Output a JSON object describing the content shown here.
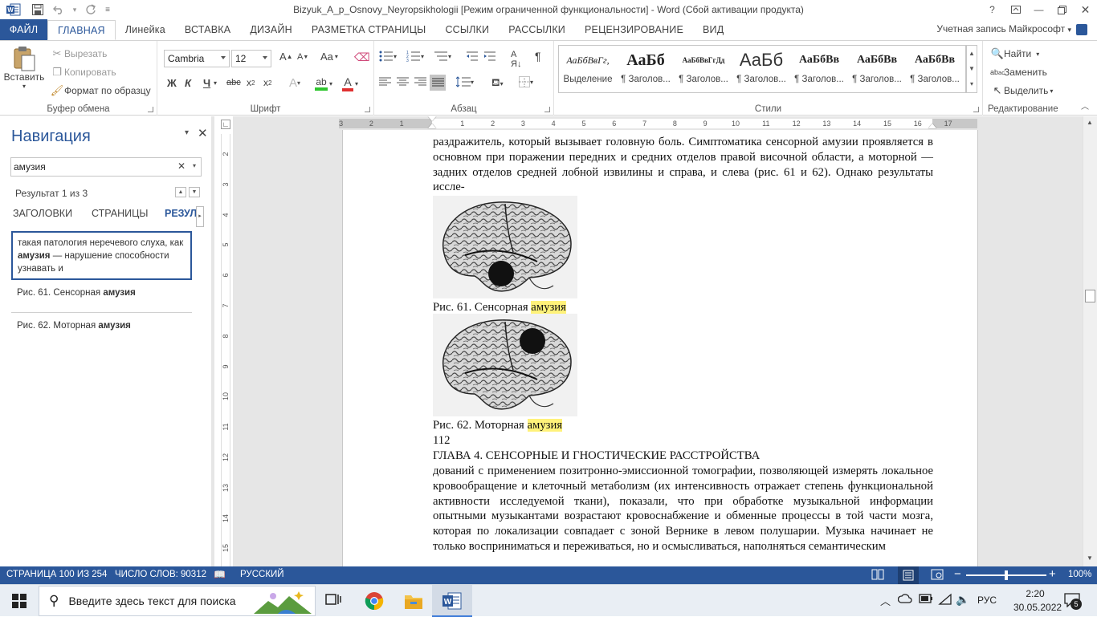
{
  "window": {
    "title": "Bizyuk_A_p_Osnovy_Neyropsikhologii [Режим ограниченной функциональности] - Word (Сбой активации продукта)",
    "account": "Учетная запись Майкрософт",
    "help": "?"
  },
  "tabs": [
    "ФАЙЛ",
    "ГЛАВНАЯ",
    "Линейка",
    "ВСТАВКА",
    "ДИЗАЙН",
    "РАЗМЕТКА СТРАНИЦЫ",
    "ССЫЛКИ",
    "РАССЫЛКИ",
    "РЕЦЕНЗИРОВАНИЕ",
    "ВИД"
  ],
  "ribbon": {
    "clipboard": {
      "label": "Буфер обмена",
      "paste": "Вставить",
      "cut": "Вырезать",
      "copy": "Копировать",
      "format_painter": "Формат по образцу"
    },
    "font": {
      "label": "Шрифт",
      "font_name": "Cambria",
      "font_size": "12",
      "bold": "Ж",
      "italic": "К",
      "underline": "Ч",
      "strike": "abc",
      "change_case": "Aa"
    },
    "paragraph": {
      "label": "Абзац"
    },
    "styles": {
      "label": "Стили",
      "items": [
        {
          "preview": "АаБбВвГг,",
          "name": "Выделение"
        },
        {
          "preview": "АаБб",
          "name": "¶ Заголов..."
        },
        {
          "preview": "АаБбВвГгДд",
          "name": "¶ Заголов..."
        },
        {
          "preview": "АаБб",
          "name": "¶ Заголов..."
        },
        {
          "preview": "АаБбВв",
          "name": "¶ Заголов..."
        },
        {
          "preview": "АаБбВв",
          "name": "¶ Заголов..."
        },
        {
          "preview": "АаБбВв",
          "name": "¶ Заголов..."
        }
      ]
    },
    "editing": {
      "label": "Редактирование",
      "find": "Найти",
      "replace": "Заменить",
      "select": "Выделить"
    }
  },
  "nav": {
    "title": "Навигация",
    "search_value": "амузия",
    "result_count": "Результат 1 из 3",
    "tabs": [
      "ЗАГОЛОВКИ",
      "СТРАНИЦЫ",
      "РЕЗУЛЬ"
    ],
    "results": [
      {
        "before": "такая патология неречевого слуха, как ",
        "match": "амузия",
        "after": " — нарушение способности узнавать и"
      },
      {
        "before": "Рис. 61. Сенсорная ",
        "match": "амузия",
        "after": ""
      },
      {
        "before": "Рис. 62. Моторная ",
        "match": "амузия",
        "after": ""
      }
    ]
  },
  "ruler": {
    "h_ticks": [
      "3",
      "2",
      "1",
      "1",
      "2",
      "3",
      "4",
      "5",
      "6",
      "7",
      "8",
      "9",
      "10",
      "11",
      "12",
      "13",
      "14",
      "15",
      "16",
      "17"
    ],
    "v_ticks": [
      "2",
      "3",
      "4",
      "5",
      "6",
      "7",
      "8",
      "9",
      "10",
      "11",
      "12",
      "13",
      "14",
      "15"
    ]
  },
  "document": {
    "para1": "раздражитель, который вызывает головную боль. Симптоматика сенсорной амузии проявляется в основном при поражении передних и средних отделов правой височной области, а моторной — задних отделов средней лобной извилины и справа, и слева (рис. 61 и 62). Однако результаты иссле-",
    "fig61_text": "Рис. 61. Сенсорная ",
    "fig62_text": "Рис. 62. Моторная ",
    "highlight_word": "амузия",
    "page_number": "112",
    "chapter": "ГЛАВА 4. СЕНСОРНЫЕ И ГНОСТИЧЕСКИЕ РАССТРОЙСТВА",
    "para2": "дований с применением позитронно-эмиссионной томографии, позволяющей измерять локальное кровообращение и клеточный метаболизм (их интенсивность отражает степень функциональной активности исследуемой ткани), показали, что при обработке музыкальной информации опытными музыкантами возрастают кровоснабжение и обменные процессы в той части мозга, которая по локализации совпадает с зоной Вернике в левом полушарии. Музыка начинает не только восприниматься и переживаться, но и осмысливаться, наполняться семантическим"
  },
  "status": {
    "page": "СТРАНИЦА 100 ИЗ 254",
    "words": "ЧИСЛО СЛОВ: 90312",
    "language": "РУССКИЙ",
    "zoom": "100%",
    "zoom_value": 100
  },
  "taskbar": {
    "search_placeholder": "Введите здесь текст для поиска",
    "lang": "РУС",
    "time": "2:20",
    "date": "30.05.2022",
    "notifications": "5"
  }
}
